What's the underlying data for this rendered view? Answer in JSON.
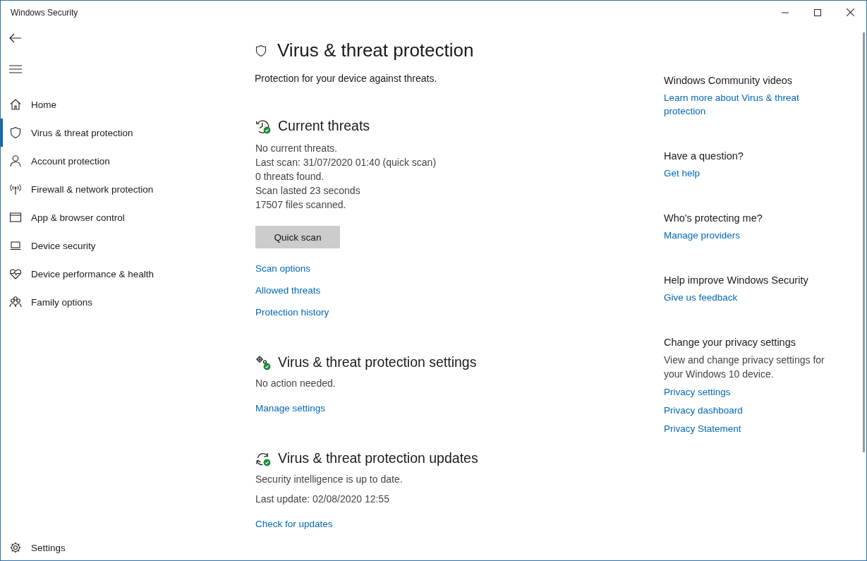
{
  "window": {
    "title": "Windows Security"
  },
  "sidebar": {
    "items": [
      {
        "label": "Home",
        "selected": false
      },
      {
        "label": "Virus & threat protection",
        "selected": true
      },
      {
        "label": "Account protection",
        "selected": false
      },
      {
        "label": "Firewall & network protection",
        "selected": false
      },
      {
        "label": "App & browser control",
        "selected": false
      },
      {
        "label": "Device security",
        "selected": false
      },
      {
        "label": "Device performance & health",
        "selected": false
      },
      {
        "label": "Family options",
        "selected": false
      }
    ],
    "settings": {
      "label": "Settings",
      "selected": false
    }
  },
  "page": {
    "title": "Virus & threat protection",
    "subtitle": "Protection for your device against threats.",
    "sections": [
      {
        "title": "Current threats",
        "lines": [
          "No current threats.",
          "Last scan: 31/07/2020 01:40 (quick scan)",
          "0 threats found.",
          "Scan lasted 23 seconds",
          "17507 files scanned."
        ],
        "button": "Quick scan",
        "links": [
          "Scan options",
          "Allowed threats",
          "Protection history"
        ]
      },
      {
        "title": "Virus & threat protection settings",
        "lines": [
          "No action needed."
        ],
        "links": [
          "Manage settings"
        ]
      },
      {
        "title": "Virus & threat protection updates",
        "lines": [
          "Security intelligence is up to date.",
          "Last update: 02/08/2020 12:55"
        ],
        "links": [
          "Check for updates"
        ]
      }
    ]
  },
  "aside": {
    "groups": [
      {
        "heading": "Windows Community videos",
        "links": [
          "Learn more about Virus & threat protection"
        ]
      },
      {
        "heading": "Have a question?",
        "links": [
          "Get help"
        ]
      },
      {
        "heading": "Who's protecting me?",
        "links": [
          "Manage providers"
        ]
      },
      {
        "heading": "Help improve Windows Security",
        "links": [
          "Give us feedback"
        ]
      },
      {
        "heading": "Change your privacy settings",
        "text": "View and change privacy settings for your Windows 10 device.",
        "links": [
          "Privacy settings",
          "Privacy dashboard",
          "Privacy Statement"
        ]
      }
    ]
  }
}
